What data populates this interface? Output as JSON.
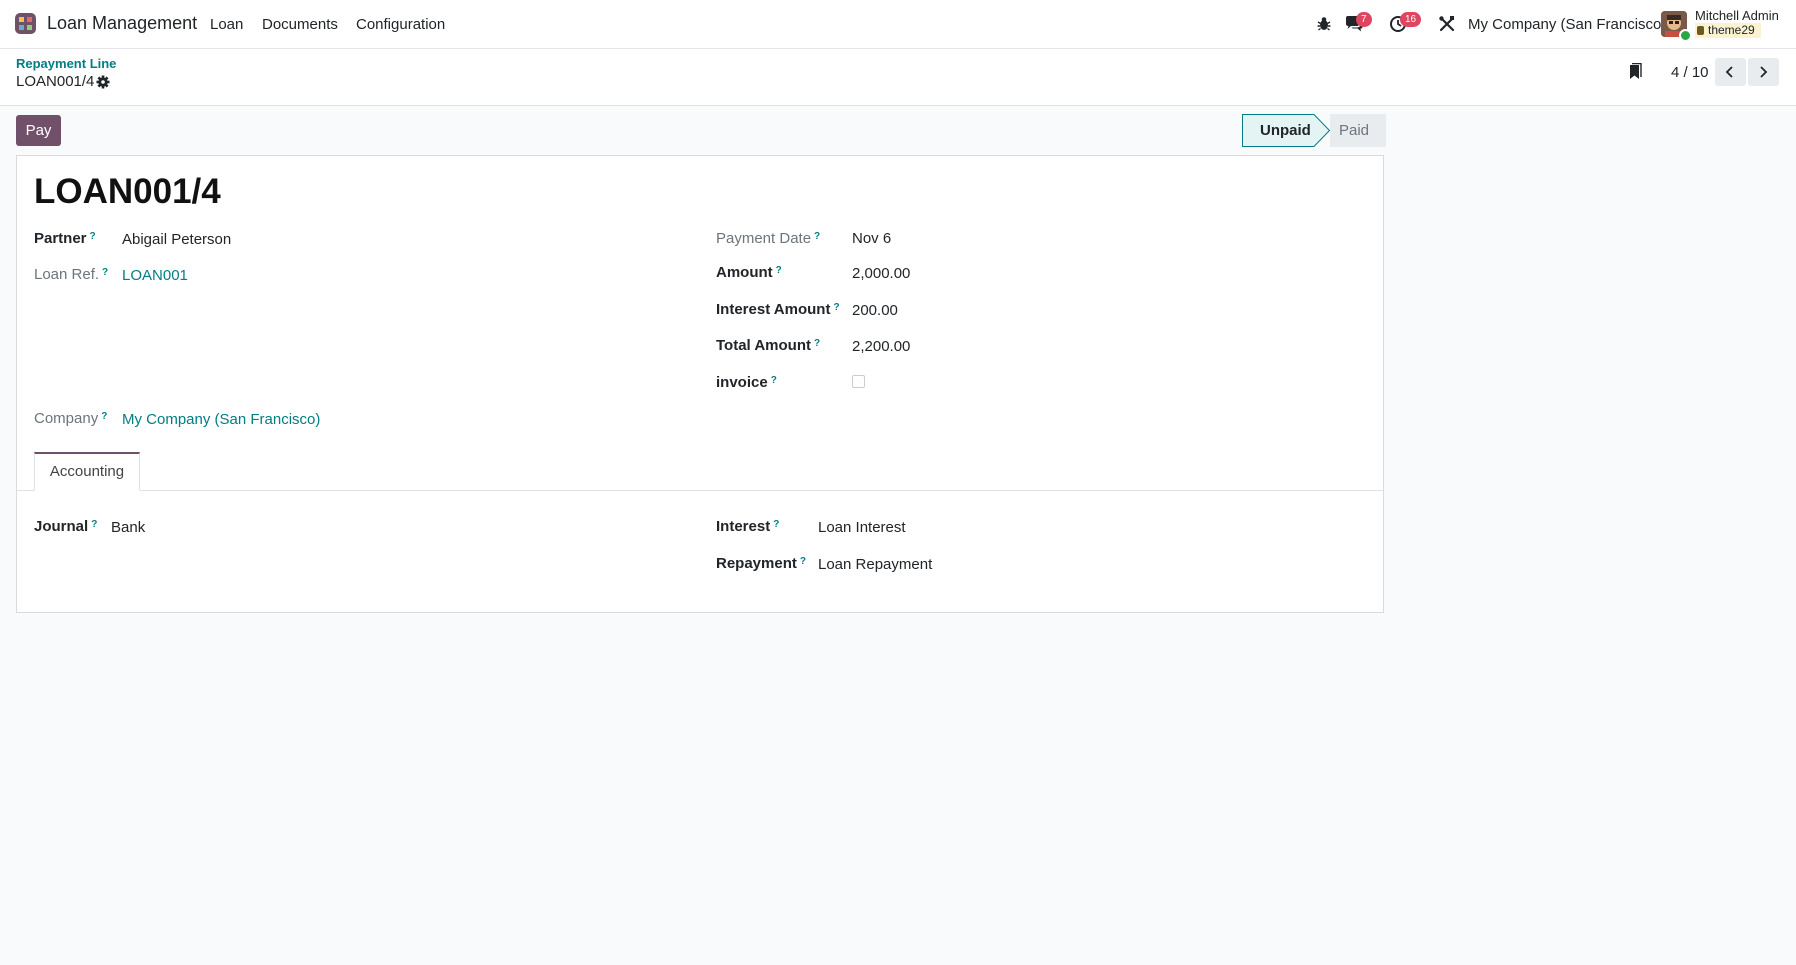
{
  "navbar": {
    "app_title": "Loan Management",
    "menus": [
      "Loan",
      "Documents",
      "Configuration"
    ],
    "messages_count": "7",
    "activities_count": "16",
    "company": "My Company (San Francisco)",
    "user_name": "Mitchell Admin",
    "database": "theme29",
    "icons": [
      "app-icon",
      "bug-icon",
      "chat-icon",
      "clock-icon",
      "tools-icon"
    ]
  },
  "control_panel": {
    "breadcrumb_parent": "Repayment Line",
    "breadcrumb_current": "LOAN001/4",
    "pager": "4 / 10"
  },
  "status": {
    "pay_label": "Pay",
    "stages": [
      "Unpaid",
      "Paid"
    ],
    "current_stage": "Unpaid"
  },
  "form": {
    "title": "LOAN001/4",
    "partner": {
      "label": "Partner",
      "value": "Abigail Peterson"
    },
    "loan_ref": {
      "label": "Loan Ref.",
      "value": "LOAN001"
    },
    "company": {
      "label": "Company",
      "value": "My Company (San Francisco)"
    },
    "payment_date": {
      "label": "Payment Date",
      "value": "Nov 6"
    },
    "amount": {
      "label": "Amount",
      "value": "2,000.00"
    },
    "interest_amount": {
      "label": "Interest Amount",
      "value": "200.00"
    },
    "total_amount": {
      "label": "Total Amount",
      "value": "2,200.00"
    },
    "invoice": {
      "label": "invoice",
      "checked": false
    },
    "help_marker": "?"
  },
  "tabs": {
    "active": "Accounting",
    "accounting": {
      "journal": {
        "label": "Journal",
        "value": "Bank"
      },
      "interest": {
        "label": "Interest",
        "value": "Loan Interest"
      },
      "repayment": {
        "label": "Repayment",
        "value": "Loan Repayment"
      }
    }
  },
  "colors": {
    "brand": "#71506a",
    "link": "#017e84",
    "badge": "#e04560",
    "stage_active_bg": "#e4f3f4"
  }
}
